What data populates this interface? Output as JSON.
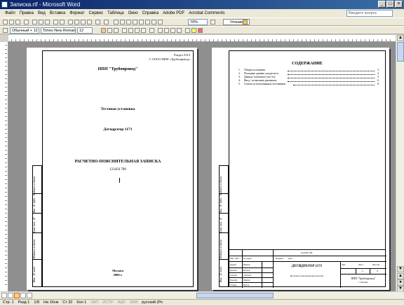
{
  "window": {
    "title": "Записка.rtf - Microsoft Word"
  },
  "menu": [
    "Файл",
    "Правка",
    "Вид",
    "Вставка",
    "Формат",
    "Сервис",
    "Таблица",
    "Окно",
    "Справка",
    "Adobe PDF",
    "Acrobat Comments"
  ],
  "ask": {
    "placeholder": "Введите вопрос"
  },
  "format": {
    "style": "Обычный + 12 п",
    "font": "Times New Roman",
    "size": "12",
    "zoom": "70%",
    "read": "Чтение"
  },
  "page1": {
    "header_line1": "Раздел 5313",
    "header_line2": "© ОООО НПП «Трубопровод»",
    "company": "НПП \"Трубопровод\"",
    "install": "Тестовая установка",
    "device": "Дегидратор 1171",
    "doc_title": "РАСЧЕТНО-ПОЯСНИТЕЛЬНАЯ ЗАПИСКА",
    "doc_code": "123456 789",
    "city": "Москва",
    "year": "2006 г.",
    "side_labels": [
      "Подпись и дата",
      "Инв. № дубл.",
      "Взам. инв. №",
      "Подпись и дата",
      "Инв. № подл."
    ]
  },
  "page2": {
    "heading": "СОДЕРЖАНИЕ",
    "toc": [
      {
        "n": "1.",
        "t": "Общие положения",
        "p": "3"
      },
      {
        "n": "2.",
        "t": "Исходные данные для расчета",
        "p": "4"
      },
      {
        "n": "3.",
        "t": "Данные элементов узла №2",
        "p": "5"
      },
      {
        "n": "4.",
        "t": "Ввод / испытание давлением",
        "p": "6"
      },
      {
        "n": "5.",
        "t": "Список использованных источников",
        "p": "8"
      }
    ],
    "stamp": {
      "code": "123456 789",
      "device": "ДЕГИДРАТОР 1171",
      "doc": "Расчетно-пояснительная записка",
      "company": "НПП \"Трубопровод\"",
      "city": "г. Москва",
      "rows": [
        "Изм. Лист",
        "Разраб.",
        "Провер.",
        "Т.контр.",
        "Н.контр.",
        "Утверд."
      ],
      "names": [
        "№ докум.",
        "Иванов",
        "Петров",
        "Сидоров",
        "Павлов",
        "Бысов"
      ],
      "cols": [
        "Подпись",
        "Дата"
      ],
      "sheet_labels": [
        "Лит.",
        "Лист",
        "Листов"
      ],
      "sheet_vals": [
        "",
        "2",
        "8"
      ]
    }
  },
  "status": {
    "page": "Стр. 1",
    "section": "Разд 1",
    "pages": "1/8",
    "at": "На 16см",
    "line": "Ст 32",
    "col": "Кол 1",
    "rec": "ЗАП",
    "track": "ИСПР",
    "ext": "ВДЛ",
    "ovr": "ЗАМ",
    "lang": "русский (Ро"
  }
}
